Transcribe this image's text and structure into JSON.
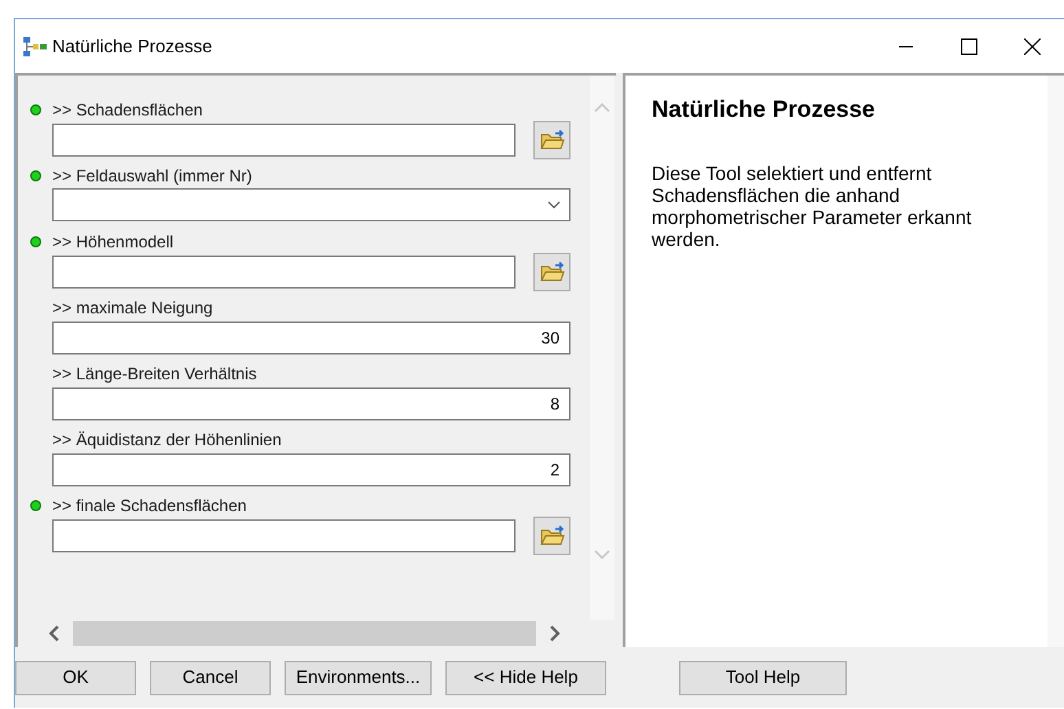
{
  "window": {
    "title": "Natürliche Prozesse"
  },
  "parameters": [
    {
      "label": ">> Schadensflächen",
      "required": true,
      "kind": "browse"
    },
    {
      "label": ">> Feldauswahl (immer Nr)",
      "required": true,
      "kind": "dropdown"
    },
    {
      "label": ">> Höhenmodell",
      "required": true,
      "kind": "browse"
    },
    {
      "label": ">> maximale Neigung",
      "required": false,
      "kind": "number",
      "value": "30"
    },
    {
      "label": ">> Länge-Breiten Verhältnis",
      "required": false,
      "kind": "number",
      "value": "8"
    },
    {
      "label": ">> Äquidistanz der Höhenlinien",
      "required": false,
      "kind": "number",
      "value": "2"
    },
    {
      "label": ">> finale Schadensflächen",
      "required": true,
      "kind": "browse"
    }
  ],
  "help": {
    "title": "Natürliche Prozesse",
    "text": "Diese Tool selektiert und entfernt Schadensflächen die anhand morphometrischer Parameter erkannt werden."
  },
  "buttons": [
    "OK",
    "Cancel",
    "Environments...",
    "<< Hide Help"
  ],
  "help_button": "Tool Help"
}
